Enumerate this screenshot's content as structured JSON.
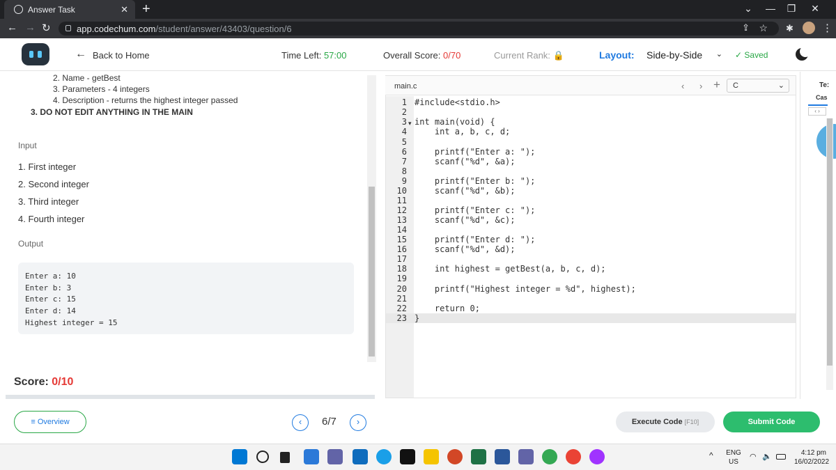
{
  "browser": {
    "tab_title": "Answer Task",
    "url_host": "app.codechum.com",
    "url_path": "/student/answer/43403/question/6"
  },
  "header": {
    "back_label": "Back to Home",
    "time_left_label": "Time Left:",
    "time_left_value": "57:00",
    "overall_score_label": "Overall Score:",
    "overall_score_value": "0/70",
    "current_rank_label": "Current Rank:",
    "layout_label": "Layout:",
    "layout_value": "Side-by-Side",
    "saved_label": "Saved"
  },
  "problem": {
    "lines": [
      "2. Name - getBest",
      "3. Parameters - 4 integers",
      "4. Description - returns the highest integer passed"
    ],
    "warning": "3. DO NOT EDIT ANYTHING IN THE MAIN",
    "input_heading": "Input",
    "inputs": [
      "1. First integer",
      "2. Second integer",
      "3. Third integer",
      "4. Fourth integer"
    ],
    "output_heading": "Output",
    "output_lines": [
      "Enter a: 10",
      "Enter b: 3",
      "Enter c: 15",
      "Enter d: 14",
      "Highest integer = 15"
    ]
  },
  "score": {
    "label": "Score:",
    "value": "0/10"
  },
  "footer": {
    "overview_label": "Overview",
    "pager": "6/7",
    "execute_label": "Execute Code",
    "execute_key": "[F10]",
    "submit_label": "Submit Code"
  },
  "editor": {
    "file_tab": "main.c",
    "language": "C",
    "line_numbers": [
      "1",
      "2",
      "3",
      "4",
      "5",
      "6",
      "7",
      "8",
      "9",
      "10",
      "11",
      "12",
      "13",
      "14",
      "15",
      "16",
      "17",
      "18",
      "19",
      "20",
      "21",
      "22",
      "23"
    ],
    "code": [
      "#include<stdio.h>",
      "",
      "int main(void) {",
      "    int a, b, c, d;",
      "",
      "    printf(\"Enter a: \");",
      "    scanf(\"%d\", &a);",
      "",
      "    printf(\"Enter b: \");",
      "    scanf(\"%d\", &b);",
      "",
      "    printf(\"Enter c: \");",
      "    scanf(\"%d\", &c);",
      "",
      "    printf(\"Enter d: \");",
      "    scanf(\"%d\", &d);",
      "",
      "    int highest = getBest(a, b, c, d);",
      "",
      "    printf(\"Highest integer = %d\", highest);",
      "",
      "    return 0;",
      "}"
    ]
  },
  "right_panel": {
    "title": "Te:",
    "subtitle": "Cas"
  },
  "taskbar": {
    "lang_top": "ENG",
    "lang_bottom": "US",
    "time": "4:12 pm",
    "date": "16/02/2022"
  },
  "colors": {
    "accent_blue": "#1f7ae0",
    "accent_green": "#28a745",
    "score_red": "#e53935",
    "submit_green": "#2dbd6e"
  }
}
